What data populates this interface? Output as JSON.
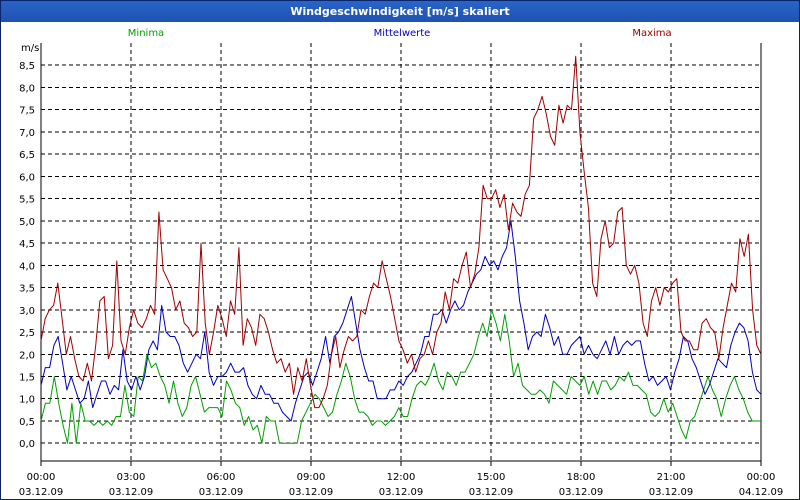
{
  "window_title": "Windgeschwindigkeit [m/s] skaliert",
  "chart_data": {
    "type": "line",
    "title": "Windgeschwindigkeit [m/s] skaliert",
    "ylabel": "m/s",
    "ylim": [
      -0.4,
      9.0
    ],
    "y_ticks": [
      "0,0",
      "0,5",
      "1,0",
      "1,5",
      "2,0",
      "2,5",
      "3,0",
      "3,5",
      "4,0",
      "4,5",
      "5,0",
      "5,5",
      "6,0",
      "6,5",
      "7,0",
      "7,5",
      "8,0",
      "8,5"
    ],
    "x_ticks": [
      {
        "time": "00:00",
        "date": "03.12.09"
      },
      {
        "time": "03:00",
        "date": "03.12.09"
      },
      {
        "time": "06:00",
        "date": "03.12.09"
      },
      {
        "time": "09:00",
        "date": "03.12.09"
      },
      {
        "time": "12:00",
        "date": "03.12.09"
      },
      {
        "time": "15:00",
        "date": "03.12.09"
      },
      {
        "time": "18:00",
        "date": "03.12.09"
      },
      {
        "time": "21:00",
        "date": "03.12.09"
      },
      {
        "time": "00:00",
        "date": "04.12.09"
      }
    ],
    "grid": true,
    "legend_placement": "top",
    "series": [
      {
        "name": "Minima",
        "color": "#00a000",
        "values": [
          0.5,
          0.9,
          0.9,
          1.5,
          0.9,
          0.4,
          0.0,
          0.9,
          0.0,
          0.9,
          0.5,
          0.5,
          0.4,
          0.5,
          0.4,
          0.5,
          0.4,
          0.6,
          0.6,
          1.3,
          0.7,
          0.6,
          1.5,
          1.4,
          2.0,
          1.7,
          1.8,
          1.5,
          1.3,
          0.9,
          1.4,
          0.9,
          0.6,
          0.8,
          1.3,
          1.5,
          1.1,
          0.7,
          0.8,
          0.8,
          0.8,
          0.6,
          1.4,
          1.2,
          0.9,
          0.8,
          0.4,
          0.6,
          0.3,
          0.4,
          0.0,
          0.6,
          0.5,
          0.5,
          0.0,
          0.0,
          0.0,
          0.0,
          0.0,
          0.5,
          0.7,
          0.9,
          1.1,
          1.0,
          0.8,
          0.6,
          0.7,
          1.1,
          1.4,
          1.8,
          1.5,
          1.0,
          0.7,
          0.7,
          0.6,
          0.4,
          0.5,
          0.5,
          0.4,
          0.5,
          0.6,
          0.8,
          0.6,
          0.6,
          1.0,
          1.3,
          1.4,
          1.3,
          1.5,
          1.8,
          1.4,
          1.2,
          1.6,
          1.5,
          1.3,
          1.6,
          1.6,
          1.8,
          2.0,
          2.4,
          2.7,
          2.4,
          3.0,
          2.7,
          2.3,
          2.9,
          2.3,
          1.5,
          1.8,
          1.3,
          1.2,
          1.1,
          1.1,
          1.2,
          1.1,
          0.9,
          1.4,
          1.3,
          1.2,
          1.1,
          1.5,
          1.4,
          1.3,
          1.5,
          1.1,
          1.4,
          1.1,
          1.4,
          1.4,
          1.2,
          1.3,
          1.5,
          1.4,
          1.6,
          1.3,
          1.3,
          1.2,
          1.1,
          0.7,
          0.6,
          0.7,
          1.0,
          0.7,
          0.9,
          0.6,
          0.3,
          0.1,
          0.5,
          0.6,
          0.9,
          1.2,
          1.5,
          1.2,
          1.0,
          0.6,
          1.0,
          1.3,
          1.5,
          1.2,
          1.0,
          0.7,
          0.5,
          0.5,
          0.5
        ]
      },
      {
        "name": "Mittelwerte",
        "color": "#0000c0",
        "values": [
          1.3,
          1.7,
          1.7,
          2.2,
          2.4,
          1.8,
          1.2,
          1.5,
          1.2,
          0.9,
          1.0,
          1.4,
          0.8,
          1.1,
          1.4,
          1.4,
          1.1,
          1.3,
          1.2,
          2.1,
          1.4,
          1.2,
          1.5,
          1.2,
          1.5,
          2.1,
          2.3,
          2.1,
          3.1,
          2.5,
          2.4,
          2.4,
          2.2,
          1.8,
          1.6,
          1.8,
          2.0,
          1.9,
          2.5,
          1.6,
          1.3,
          1.5,
          1.5,
          1.6,
          1.8,
          1.6,
          1.6,
          1.7,
          1.3,
          1.1,
          1.0,
          1.3,
          1.1,
          1.1,
          0.9,
          0.9,
          0.7,
          0.6,
          0.5,
          0.9,
          1.2,
          1.5,
          1.6,
          1.3,
          1.6,
          1.9,
          2.4,
          1.8,
          2.4,
          2.5,
          2.7,
          3.0,
          3.3,
          2.7,
          2.1,
          1.7,
          1.4,
          1.4,
          1.0,
          1.0,
          1.0,
          1.2,
          1.2,
          1.4,
          1.3,
          1.5,
          1.6,
          1.8,
          2.0,
          2.4,
          2.4,
          2.9,
          2.9,
          3.0,
          2.7,
          3.0,
          3.2,
          3.0,
          3.1,
          3.4,
          3.6,
          3.8,
          3.9,
          4.2,
          4.0,
          4.1,
          3.9,
          4.2,
          4.4,
          5.0,
          4.2,
          3.2,
          2.7,
          2.1,
          2.4,
          2.5,
          2.4,
          2.9,
          2.6,
          2.2,
          2.4,
          2.0,
          2.0,
          2.2,
          2.3,
          2.4,
          2.0,
          2.2,
          2.0,
          1.9,
          2.1,
          2.3,
          2.0,
          2.4,
          2.0,
          2.2,
          2.3,
          2.2,
          2.3,
          2.3,
          1.8,
          1.4,
          1.5,
          1.3,
          1.4,
          1.5,
          1.2,
          1.6,
          1.9,
          2.4,
          2.3,
          1.9,
          1.7,
          1.4,
          1.1,
          1.3,
          1.6,
          1.9,
          1.8,
          1.7,
          2.2,
          2.5,
          2.7,
          2.6,
          2.3,
          1.6,
          1.2,
          1.1
        ]
      },
      {
        "name": "Maxima",
        "color": "#a00000",
        "values": [
          2.3,
          2.8,
          3.0,
          3.1,
          3.6,
          2.8,
          2.0,
          2.4,
          1.9,
          1.5,
          1.4,
          1.8,
          1.4,
          2.2,
          3.2,
          3.3,
          1.9,
          2.2,
          4.1,
          2.3,
          2.0,
          2.6,
          3.0,
          2.7,
          2.6,
          2.8,
          3.1,
          2.9,
          5.2,
          3.9,
          3.7,
          3.5,
          3.0,
          3.2,
          2.7,
          2.6,
          2.4,
          2.5,
          4.5,
          2.7,
          2.0,
          2.5,
          3.1,
          2.8,
          2.4,
          3.2,
          2.9,
          4.4,
          2.2,
          2.8,
          2.6,
          2.2,
          2.9,
          2.8,
          2.5,
          2.1,
          1.8,
          1.9,
          1.6,
          1.8,
          1.1,
          1.7,
          1.4,
          1.9,
          1.3,
          0.8,
          0.8,
          1.0,
          1.3,
          2.0,
          2.4,
          1.7,
          2.1,
          2.4,
          2.3,
          2.4,
          3.0,
          2.9,
          3.3,
          3.6,
          3.5,
          4.1,
          3.7,
          3.3,
          2.8,
          2.3,
          2.1,
          1.8,
          2.0,
          1.6,
          1.9,
          2.0,
          2.3,
          2.0,
          2.5,
          2.7,
          3.4,
          3.0,
          3.7,
          3.6,
          4.0,
          4.3,
          3.5,
          3.8,
          4.4,
          5.8,
          5.5,
          5.5,
          5.7,
          5.3,
          5.6,
          4.8,
          5.4,
          5.2,
          5.1,
          5.6,
          5.8,
          7.3,
          7.5,
          7.8,
          7.4,
          6.9,
          6.7,
          7.6,
          7.2,
          7.6,
          7.5,
          8.7,
          7.0,
          6.1,
          5.3,
          3.6,
          3.3,
          4.6,
          5.0,
          4.4,
          4.5,
          5.2,
          5.3,
          4.0,
          3.8,
          4.0,
          3.6,
          2.7,
          2.4,
          3.2,
          3.5,
          3.1,
          3.5,
          3.4,
          3.6,
          3.7,
          2.5,
          2.3,
          2.3,
          2.1,
          2.1,
          2.7,
          2.8,
          2.6,
          2.5,
          1.9,
          2.6,
          3.1,
          3.6,
          3.4,
          4.6,
          4.2,
          4.7,
          3.0,
          2.2,
          2.0
        ]
      }
    ]
  }
}
